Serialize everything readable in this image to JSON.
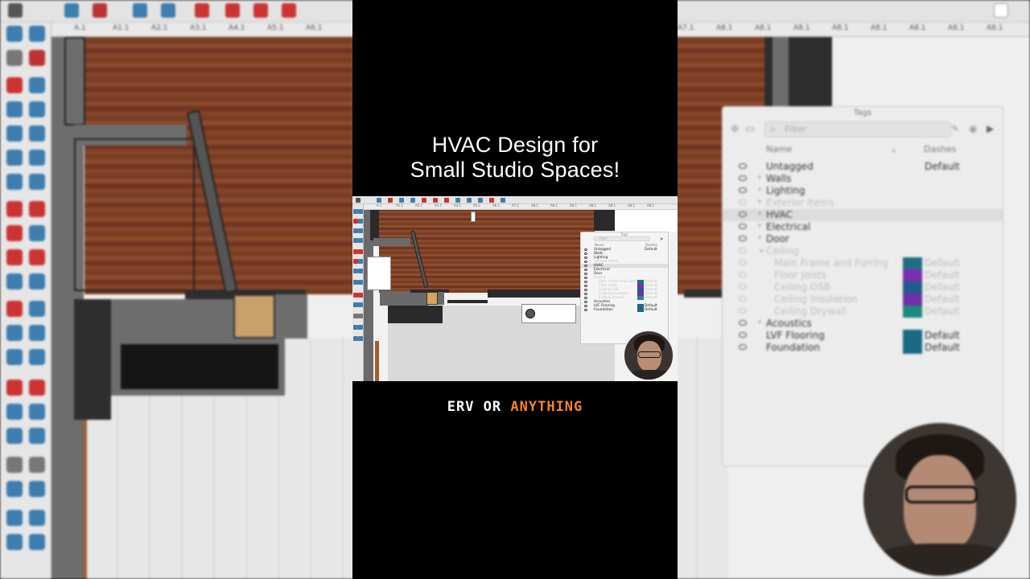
{
  "video": {
    "title_line1": "HVAC Design for",
    "title_line2": "Small Studio Spaces!",
    "caption_word1": "ERV OR",
    "caption_word2": "ANYTHING",
    "caption_word1_color": "#ffffff",
    "caption_word2_color": "#f5832b"
  },
  "ruler": {
    "labels": [
      "A.1",
      "A1.1",
      "A2.1",
      "A3.1",
      "A4.1",
      "A5.1",
      "A6.1",
      "A7.1",
      "A8.1",
      "A8.1",
      "A8.1",
      "A8.1",
      "A8.1",
      "A8.1",
      "A8.1",
      "A8.1"
    ]
  },
  "tags_panel": {
    "title": "Tags",
    "search_placeholder": "Filter",
    "col_name": "Name",
    "col_dashes": "Dashes",
    "rows": [
      {
        "name": "Untagged",
        "dashes": "Default",
        "state": "normal",
        "indent": 0,
        "arrow": "",
        "swatch": ""
      },
      {
        "name": "Walls",
        "dashes": "",
        "state": "normal",
        "indent": 0,
        "arrow": "›",
        "swatch": ""
      },
      {
        "name": "Lighting",
        "dashes": "",
        "state": "normal",
        "indent": 0,
        "arrow": "›",
        "swatch": ""
      },
      {
        "name": "Exterior Items",
        "dashes": "",
        "state": "hidden",
        "indent": 0,
        "arrow": "›",
        "swatch": ""
      },
      {
        "name": "HVAC",
        "dashes": "",
        "state": "selected",
        "indent": 0,
        "arrow": "›",
        "swatch": ""
      },
      {
        "name": "Electrical",
        "dashes": "",
        "state": "normal",
        "indent": 0,
        "arrow": "›",
        "swatch": ""
      },
      {
        "name": "Door",
        "dashes": "",
        "state": "normal",
        "indent": 0,
        "arrow": "›",
        "swatch": ""
      },
      {
        "name": "Ceiling",
        "dashes": "",
        "state": "hidden",
        "indent": 0,
        "arrow": "⌄",
        "swatch": ""
      },
      {
        "name": "Main Frame and Furring",
        "dashes": "Default",
        "state": "dim",
        "indent": 1,
        "arrow": "",
        "swatch": "#1e6f84"
      },
      {
        "name": "Floor Joists",
        "dashes": "Default",
        "state": "dim",
        "indent": 1,
        "arrow": "",
        "swatch": "#7a2fb0"
      },
      {
        "name": "Ceiling OSB",
        "dashes": "Default",
        "state": "dim",
        "indent": 1,
        "arrow": "",
        "swatch": "#1f5c8a"
      },
      {
        "name": "Ceiling Insulation",
        "dashes": "Default",
        "state": "dim",
        "indent": 1,
        "arrow": "",
        "swatch": "#6e2fa8"
      },
      {
        "name": "Ceiling Drywall",
        "dashes": "Default",
        "state": "dim",
        "indent": 1,
        "arrow": "",
        "swatch": "#1e8a7a"
      },
      {
        "name": "Acoustics",
        "dashes": "",
        "state": "normal",
        "indent": 0,
        "arrow": "›",
        "swatch": ""
      },
      {
        "name": "LVF Flooring",
        "dashes": "Default",
        "state": "normal",
        "indent": 0,
        "arrow": "",
        "swatch": "#1a6a86"
      },
      {
        "name": "Foundation",
        "dashes": "Default",
        "state": "normal",
        "indent": 0,
        "arrow": "",
        "swatch": "#1a6a86"
      }
    ]
  }
}
